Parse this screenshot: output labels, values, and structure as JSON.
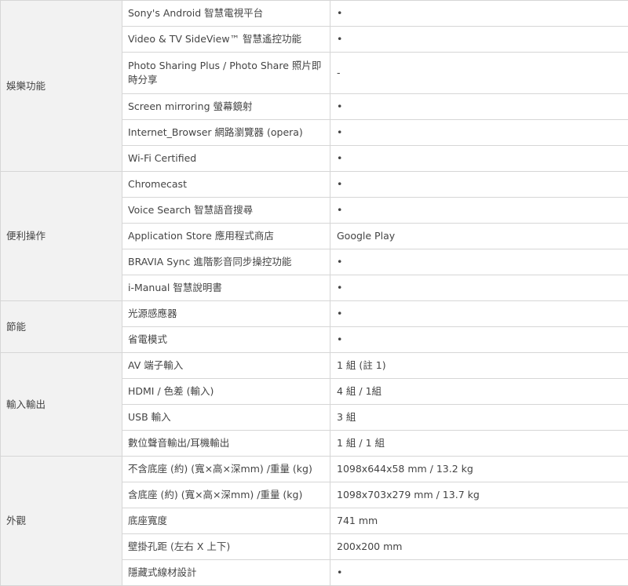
{
  "groups": [
    {
      "category": "娛樂功能",
      "rows": [
        {
          "feature": "Sony's Android 智慧電視平台",
          "value": "•"
        },
        {
          "feature": "Video & TV SideView™ 智慧遙控功能",
          "value": "•"
        },
        {
          "feature": "Photo Sharing Plus / Photo Share 照片即時分享",
          "value": "-"
        },
        {
          "feature": "Screen mirroring 螢幕鏡射",
          "value": "•"
        },
        {
          "feature": "Internet_Browser 網路瀏覽器 (opera)",
          "value": "•"
        },
        {
          "feature": "Wi-Fi Certified",
          "value": "•"
        }
      ]
    },
    {
      "category": "便利操作",
      "rows": [
        {
          "feature": "Chromecast",
          "value": "•"
        },
        {
          "feature": "Voice Search 智慧語音搜尋",
          "value": "•"
        },
        {
          "feature": "Application Store 應用程式商店",
          "value": "Google Play"
        },
        {
          "feature": "BRAVIA Sync 進階影音同步操控功能",
          "value": "•"
        },
        {
          "feature": "i-Manual 智慧說明書",
          "value": "•"
        }
      ]
    },
    {
      "category": "節能",
      "rows": [
        {
          "feature": "光源感應器",
          "value": "•"
        },
        {
          "feature": "省電模式",
          "value": "•"
        }
      ]
    },
    {
      "category": "輸入輸出",
      "rows": [
        {
          "feature": "AV 端子輸入",
          "value": "1 組 (註 1)"
        },
        {
          "feature": "HDMI / 色差 (輸入)",
          "value": "4 組 / 1組"
        },
        {
          "feature": "USB 輸入",
          "value": "3 組"
        },
        {
          "feature": "數位聲音輸出/耳機輸出",
          "value": "1 組 / 1 組"
        }
      ]
    },
    {
      "category": "外觀",
      "rows": [
        {
          "feature": "不含底座 (約) (寬×高×深mm) /重量 (kg)",
          "value": "1098x644x58 mm / 13.2 kg"
        },
        {
          "feature": "含底座 (約) (寬×高×深mm) /重量 (kg)",
          "value": "1098x703x279 mm / 13.7 kg"
        },
        {
          "feature": "底座寬度",
          "value": "741 mm"
        },
        {
          "feature": "壁掛孔距 (左右 X 上下)",
          "value": "200x200 mm"
        },
        {
          "feature": "隱藏式線材設計",
          "value": "•"
        }
      ]
    }
  ]
}
